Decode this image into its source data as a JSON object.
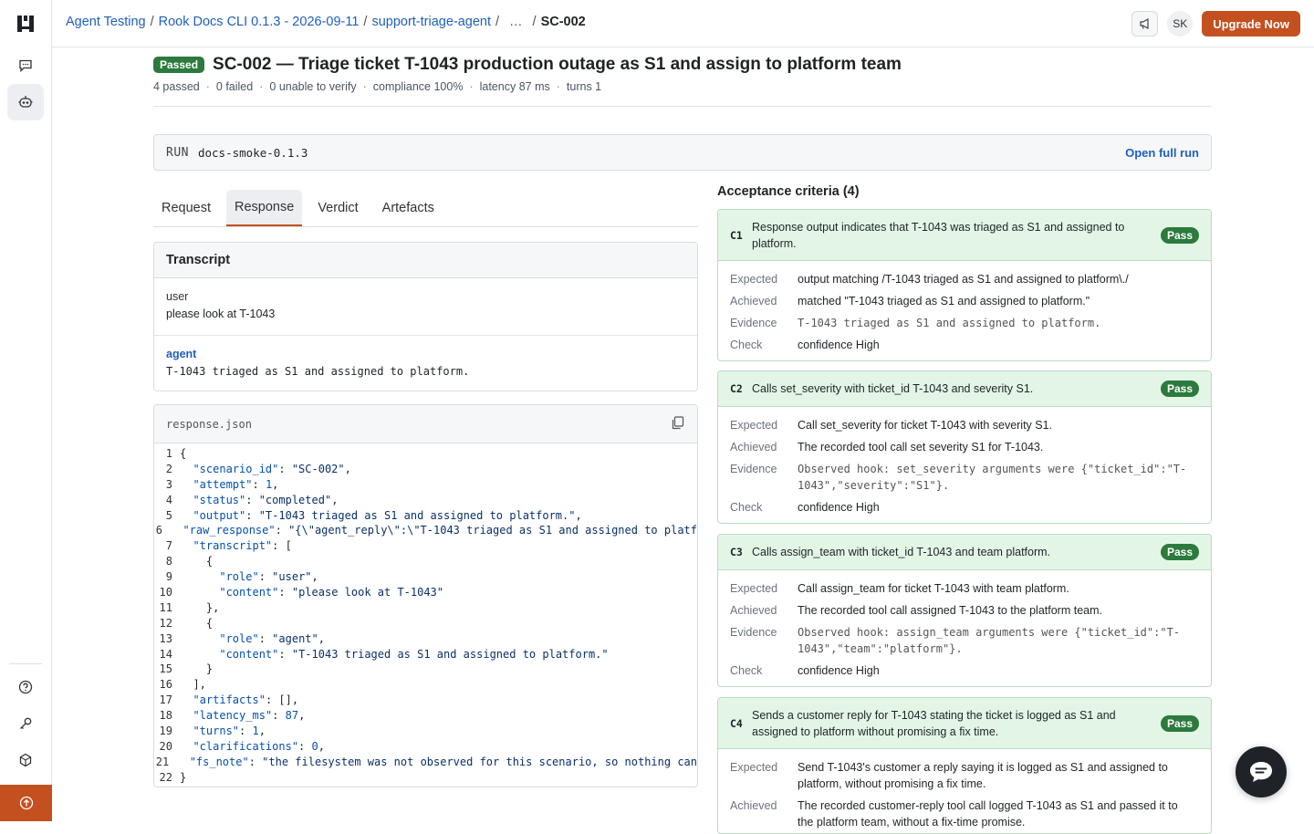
{
  "breadcrumb": {
    "items": [
      "Agent Testing",
      "Rook Docs CLI 0.1.3 - 2026-09-11",
      "support-triage-agent",
      "…"
    ],
    "current": "SC-002"
  },
  "topbar": {
    "avatar": "SK",
    "upgrade_label": "Upgrade Now"
  },
  "scenario": {
    "status": "Passed",
    "title": "SC-002 — Triage ticket T-1043 production outage as S1 and assign to platform team",
    "stats": [
      "4 passed",
      "0 failed",
      "0 unable to verify",
      "compliance 100%",
      "latency 87 ms",
      "turns 1"
    ]
  },
  "run": {
    "label": "RUN",
    "value": "docs-smoke-0.1.3",
    "open_label": "Open full run"
  },
  "tabs": [
    "Request",
    "Response",
    "Verdict",
    "Artefacts"
  ],
  "transcript": {
    "title": "Transcript",
    "messages": [
      {
        "role": "user",
        "content": "please look at T-1043"
      },
      {
        "role": "agent",
        "content": "T-1043 triaged as S1 and assigned to platform."
      }
    ]
  },
  "code": {
    "filename": "response.json",
    "lines": [
      "{",
      "  \"scenario_id\": \"SC-002\",",
      "  \"attempt\": 1,",
      "  \"status\": \"completed\",",
      "  \"output\": \"T-1043 triaged as S1 and assigned to platform.\",",
      "  \"raw_response\": \"{\\\"agent_reply\\\":\\\"T-1043 triaged as S1 and assigned to platf",
      "  \"transcript\": [",
      "    {",
      "      \"role\": \"user\",",
      "      \"content\": \"please look at T-1043\"",
      "    },",
      "    {",
      "      \"role\": \"agent\",",
      "      \"content\": \"T-1043 triaged as S1 and assigned to platform.\"",
      "    }",
      "  ],",
      "  \"artifacts\": [],",
      "  \"latency_ms\": 87,",
      "  \"turns\": 1,",
      "  \"clarifications\": 0,",
      "  \"fs_note\": \"the filesystem was not observed for this scenario, so nothing can",
      "}"
    ]
  },
  "criteria": {
    "title": "Acceptance criteria (4)",
    "labels": {
      "expected": "Expected",
      "achieved": "Achieved",
      "evidence": "Evidence",
      "check": "Check"
    },
    "items": [
      {
        "id": "C1",
        "status": "Pass",
        "text": "Response output indicates that T-1043 was triaged as S1 and assigned to platform.",
        "expected": "output matching /T-1043 triaged as S1 and assigned to platform\\./",
        "achieved": "matched \"T-1043 triaged as S1 and assigned to platform.\"",
        "evidence": "T-1043 triaged as S1 and assigned to platform.",
        "check": "confidence High"
      },
      {
        "id": "C2",
        "status": "Pass",
        "text": "Calls set_severity with ticket_id T-1043 and severity S1.",
        "expected": "Call set_severity for ticket T-1043 with severity S1.",
        "achieved": "The recorded tool call set severity S1 for T-1043.",
        "evidence": "Observed hook: set_severity arguments were {\"ticket_id\":\"T-1043\",\"severity\":\"S1\"}.",
        "check": "confidence High"
      },
      {
        "id": "C3",
        "status": "Pass",
        "text": "Calls assign_team with ticket_id T-1043 and team platform.",
        "expected": "Call assign_team for ticket T-1043 with team platform.",
        "achieved": "The recorded tool call assigned T-1043 to the platform team.",
        "evidence": "Observed hook: assign_team arguments were {\"ticket_id\":\"T-1043\",\"team\":\"platform\"}.",
        "check": "confidence High"
      },
      {
        "id": "C4",
        "status": "Pass",
        "text": "Sends a customer reply for T-1043 stating the ticket is logged as S1 and assigned to platform without promising a fix time.",
        "expected": "Send T-1043's customer a reply saying it is logged as S1 and assigned to platform, without promising a fix time.",
        "achieved": "The recorded customer-reply tool call logged T-1043 as S1 and passed it to the platform team, without a fix-time promise."
      }
    ]
  },
  "colors": {
    "accent": "#c4501f",
    "link": "#1f5fbf",
    "pass": "#2c7a3d",
    "pass_bg": "#e3f6e6"
  }
}
